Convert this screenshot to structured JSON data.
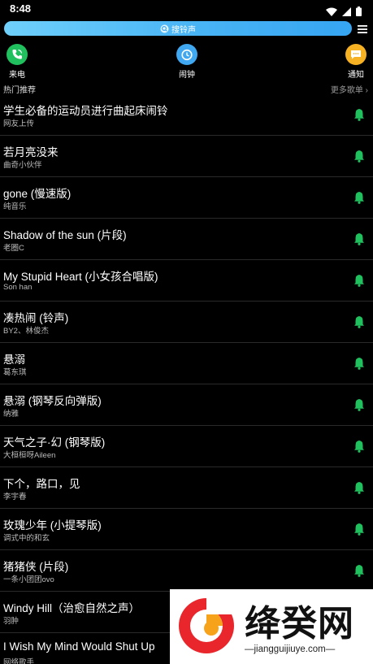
{
  "status_bar": {
    "time": "8:48"
  },
  "search": {
    "label": "搜铃声"
  },
  "quick_actions": [
    {
      "label": "来电",
      "icon": "phone-icon",
      "color": "#21c05f"
    },
    {
      "label": "闹钟",
      "icon": "alarm-clock-icon",
      "color": "#3fa8f0"
    },
    {
      "label": "通知",
      "icon": "message-icon",
      "color": "#f6b223"
    }
  ],
  "section": {
    "title": "热门推荐",
    "more": "更多歌单 ›"
  },
  "ringtones": [
    {
      "title": "学生必备的运动员进行曲起床闹铃",
      "artist": "网友上传"
    },
    {
      "title": "若月亮没来",
      "artist": "曲奇小伙伴"
    },
    {
      "title": "gone (慢速版)",
      "artist": "纯音乐"
    },
    {
      "title": "Shadow of the sun (片段)",
      "artist": "老圈C"
    },
    {
      "title": "My Stupid Heart (小女孩合唱版)",
      "artist": "Son han"
    },
    {
      "title": "凑热闹 (铃声)",
      "artist": "BY2、林俊杰"
    },
    {
      "title": "悬溺",
      "artist": "葛东琪"
    },
    {
      "title": "悬溺 (钢琴反向弹版)",
      "artist": "纳雅"
    },
    {
      "title": "天气之子·幻 (钢琴版)",
      "artist": "大桓桓呀Aileen"
    },
    {
      "title": "下个，路口，见",
      "artist": "李宇春"
    },
    {
      "title": "玫瑰少年 (小提琴版)",
      "artist": "调式中的和玄"
    },
    {
      "title": "猪猪侠 (片段)",
      "artist": "一条小团团ovo"
    },
    {
      "title": "Windy Hill（治愈自然之声）",
      "artist": "羽肿"
    },
    {
      "title": "I Wish My Mind Would Shut Up",
      "artist": "网络歌手"
    }
  ],
  "accent_color": "#21c05f",
  "watermark": {
    "name": "绛癸网",
    "url": "—jiangguijiuye.com—"
  }
}
